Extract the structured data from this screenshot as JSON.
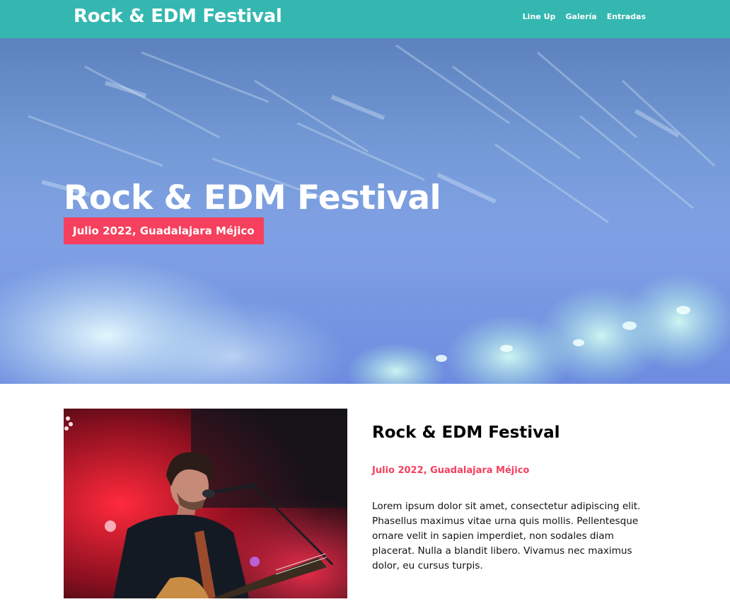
{
  "nav": {
    "brand": "Rock & EDM Festival",
    "links": [
      "Line Up",
      "Galería",
      "Entradas"
    ]
  },
  "hero": {
    "title": "Rock & EDM Festival",
    "date": "Julio 2022, Guadalajara Méjico"
  },
  "about": {
    "title": "Rock & EDM Festival",
    "date": "Julio 2022, Guadalajara Méjico",
    "text": "Lorem ipsum dolor sit amet, consectetur adipiscing elit. Phasellus maximus vitae urna quis mollis. Pellentesque ornare velit in sapien imperdiet, non sodales diam placerat. Nulla a blandit libero. Vivamus nec maximus dolor, eu cursus turpis."
  },
  "colors": {
    "navbar": "#34b7b0",
    "accent": "#f6405e",
    "hero_tint": "#7aa0dc"
  }
}
